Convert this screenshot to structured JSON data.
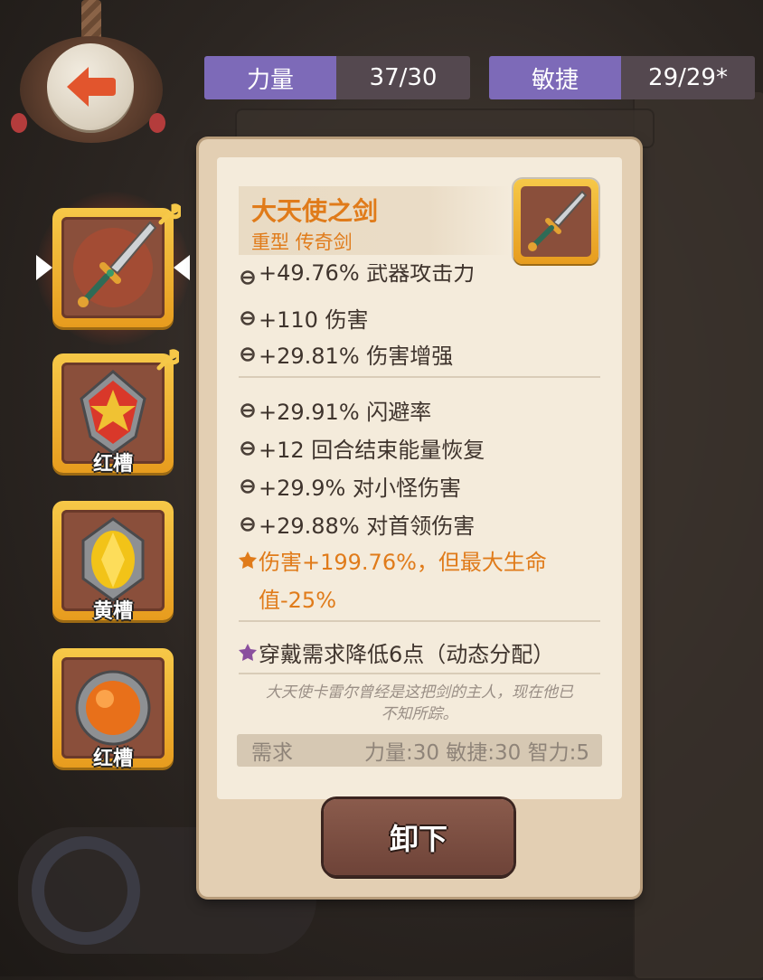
{
  "stats_header": {
    "strength": {
      "label": "力量",
      "value": "37/30"
    },
    "agility": {
      "label": "敏捷",
      "value": "29/29*"
    }
  },
  "slots": [
    {
      "name": "",
      "icon": "sword-icon",
      "selected": true,
      "upgradable": true
    },
    {
      "name": "红槽",
      "icon": "red-gem-icon",
      "upgradable": true
    },
    {
      "name": "黄槽",
      "icon": "yellow-gem-icon"
    },
    {
      "name": "红槽",
      "icon": "orange-orb-icon"
    }
  ],
  "item": {
    "name": "大天使之剑",
    "type": "重型 传奇剑",
    "icon": "sword-icon"
  },
  "attributes": {
    "group1": [
      "+49.76% 武器攻击力",
      "+110 伤害",
      "+29.81% 伤害增强"
    ],
    "group2": [
      "+29.91% 闪避率",
      "+12 回合结束能量恢复",
      "+29.9% 对小怪伤害",
      "+29.88% 对首领伤害"
    ],
    "special_line1": "伤害+199.76%，但最大生命",
    "special_line2": "值-25%",
    "enchant": "穿戴需求降低6点（动态分配）"
  },
  "description_line1": "大天使卡雷尔曾经是这把剑的主人，现在他已",
  "description_line2": "不知所踪。",
  "requirements": {
    "label": "需求",
    "values": "力量:30 敏捷:30 智力:5"
  },
  "unequip_label": "卸下",
  "colors": {
    "accent_orange": "#e07b1a",
    "stat_label_purple": "#7d6ab8",
    "slot_gold": "#f0b838"
  }
}
